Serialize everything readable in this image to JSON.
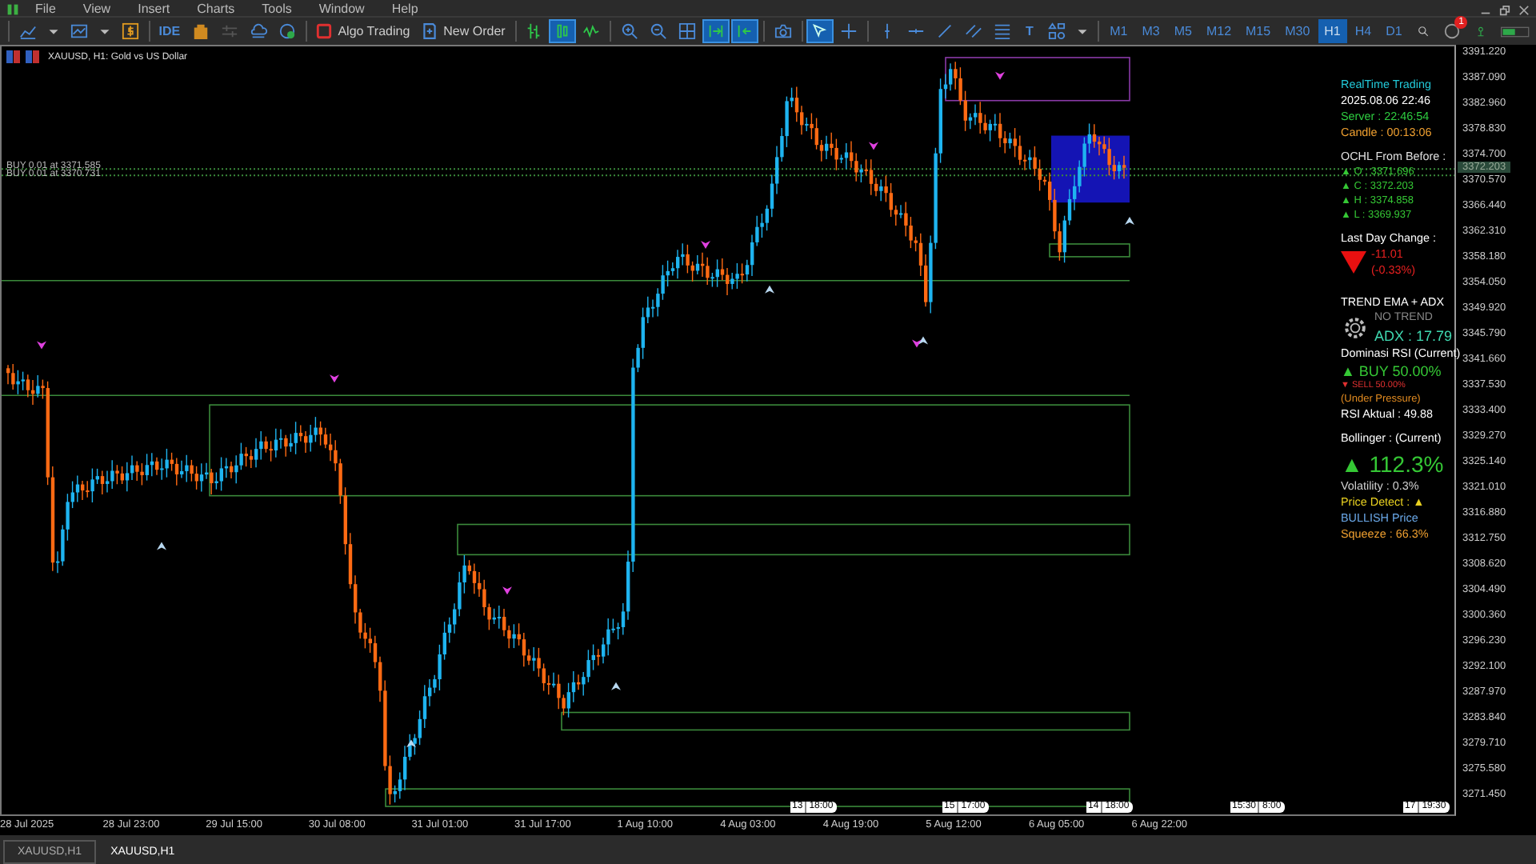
{
  "menu": [
    "File",
    "View",
    "Insert",
    "Charts",
    "Tools",
    "Window",
    "Help"
  ],
  "toolbar": [
    [
      {
        "kind": "linechart",
        "selected": false
      },
      {
        "kind": "caret",
        "selected": false
      },
      {
        "kind": "template",
        "selected": false
      },
      {
        "kind": "caret",
        "selected": false
      },
      {
        "kind": "dollar",
        "selected": false
      }
    ],
    [
      {
        "kind": "text",
        "label": "IDE",
        "selected": false
      },
      {
        "kind": "bag",
        "selected": false
      },
      {
        "kind": "sliders",
        "selected": false
      },
      {
        "kind": "cloud",
        "selected": false
      },
      {
        "kind": "vps",
        "selected": false
      }
    ],
    [
      {
        "kind": "algo",
        "label": "Algo Trading",
        "selected": false
      },
      {
        "kind": "order",
        "label": "New Order",
        "selected": false
      }
    ],
    [
      {
        "kind": "bars",
        "selected": false
      },
      {
        "kind": "candles",
        "selected": true
      },
      {
        "kind": "wave",
        "selected": false
      }
    ],
    [
      {
        "kind": "zoomin",
        "selected": false
      },
      {
        "kind": "zoomout",
        "selected": false
      },
      {
        "kind": "grid",
        "selected": false
      },
      {
        "kind": "scroll",
        "selected": true
      },
      {
        "kind": "shift",
        "selected": true
      }
    ],
    [
      {
        "kind": "camera",
        "selected": false
      }
    ],
    [
      {
        "kind": "cursor",
        "selected": true
      },
      {
        "kind": "crosshair",
        "selected": false
      }
    ],
    [
      {
        "kind": "vline",
        "selected": false
      },
      {
        "kind": "hline",
        "selected": false
      },
      {
        "kind": "trend",
        "selected": false
      },
      {
        "kind": "channel",
        "selected": false
      },
      {
        "kind": "fibo",
        "selected": false
      },
      {
        "kind": "text",
        "label": "T",
        "selected": false
      },
      {
        "kind": "shapes",
        "selected": false
      },
      {
        "kind": "caret",
        "selected": false
      }
    ]
  ],
  "timeframes": [
    {
      "label": "M1",
      "selected": false
    },
    {
      "label": "M3",
      "selected": false
    },
    {
      "label": "M5",
      "selected": false
    },
    {
      "label": "M12",
      "selected": false
    },
    {
      "label": "M15",
      "selected": false
    },
    {
      "label": "M30",
      "selected": false
    },
    {
      "label": "H1",
      "selected": true
    },
    {
      "label": "H4",
      "selected": false
    },
    {
      "label": "D1",
      "selected": false
    }
  ],
  "notification_badge": "1",
  "chart": {
    "title": "XAUUSD, H1:  Gold vs US Dollar",
    "orders": [
      "BUY 0.01 at 3371.585",
      "BUY 0.01 at 3370.731"
    ],
    "current_price": "3372.203",
    "price_axis": [
      "3391.220",
      "3387.090",
      "3382.960",
      "3378.830",
      "3374.700",
      "3370.570",
      "3366.440",
      "3362.310",
      "3358.180",
      "3354.050",
      "3349.920",
      "3345.790",
      "3341.660",
      "3337.530",
      "3333.400",
      "3329.270",
      "3325.140",
      "3321.010",
      "3316.880",
      "3312.750",
      "3308.620",
      "3304.490",
      "3300.360",
      "3296.230",
      "3292.100",
      "3287.970",
      "3283.840",
      "3279.710",
      "3275.580",
      "3271.450"
    ],
    "time_axis": [
      "28 Jul 2025",
      "28 Jul 23:00",
      "29 Jul 15:00",
      "30 Jul 08:00",
      "31 Jul 01:00",
      "31 Jul 17:00",
      "1 Aug 10:00",
      "4 Aug 03:00",
      "4 Aug 19:00",
      "5 Aug 12:00",
      "6 Aug 05:00",
      "6 Aug 22:00"
    ],
    "events": [
      [
        "13",
        "18:00"
      ],
      [
        "15",
        "17:00"
      ],
      [
        "14",
        "18:00"
      ],
      [
        "15:30",
        "8:00"
      ],
      [
        "17",
        "19:30"
      ]
    ]
  },
  "info_panel": [
    {
      "kind": "title",
      "text": "RealTime Trading",
      "color": "#22c8d8"
    },
    {
      "kind": "text",
      "text": "2025.08.06 22:46",
      "color": "#ffffff"
    },
    {
      "kind": "text",
      "text": "Server : 22:46:54",
      "color": "#2ecc40"
    },
    {
      "kind": "text",
      "text": "Candle : 00:13:06",
      "color": "#f0a030"
    },
    {
      "kind": "title",
      "text": "OCHL From Before :",
      "color": "#e0e0e0"
    },
    {
      "kind": "small",
      "text": "▲ O : 3371.696",
      "color": "#35c835"
    },
    {
      "kind": "small",
      "text": "▲ C : 3372.203",
      "color": "#35c835"
    },
    {
      "kind": "small",
      "text": "▲ H : 3374.858",
      "color": "#35c835"
    },
    {
      "kind": "small",
      "text": "▲ L : 3369.937",
      "color": "#35c835"
    },
    {
      "kind": "title",
      "text": "Last Day Change :",
      "color": "#ffffff"
    },
    {
      "kind": "change",
      "values": [
        "-11.01",
        "(-0.33%)"
      ],
      "color": "#e82020"
    },
    {
      "kind": "title",
      "text": "TREND EMA + ADX",
      "color": "#ffffff"
    },
    {
      "kind": "trend",
      "values": [
        "NO TREND",
        "ADX : 17.79"
      ],
      "color": "#3fd8b0"
    },
    {
      "kind": "text",
      "text": "Dominasi RSI (Current)",
      "color": "#ffffff"
    },
    {
      "kind": "big",
      "text": "▲ BUY 50.00%",
      "color": "#35c835"
    },
    {
      "kind": "tiny",
      "text": "▼ SELL 50.00%",
      "color": "#e03030"
    },
    {
      "kind": "small",
      "text": "(Under Pressure)",
      "color": "#e08a20"
    },
    {
      "kind": "text",
      "text": "RSI Aktual : 49.88",
      "color": "#ffffff"
    },
    {
      "kind": "title",
      "text": "Bollinger : (Current)",
      "color": "#ffffff"
    },
    {
      "kind": "huge",
      "text": "▲ 112.3%",
      "color": "#35c835"
    },
    {
      "kind": "text",
      "text": "Volatility : 0.3%",
      "color": "#d0d0d0"
    },
    {
      "kind": "text",
      "text": "Price Detect : ▲",
      "color": "#e8d020"
    },
    {
      "kind": "text",
      "text": "BULLISH Price",
      "color": "#6aa8e8"
    },
    {
      "kind": "text",
      "text": "Squeeze : 66.3%",
      "color": "#f0a030"
    }
  ],
  "tabs": [
    {
      "label": "XAUUSD,H1",
      "selected": false
    },
    {
      "label": "XAUUSD,H1",
      "selected": true
    }
  ]
}
